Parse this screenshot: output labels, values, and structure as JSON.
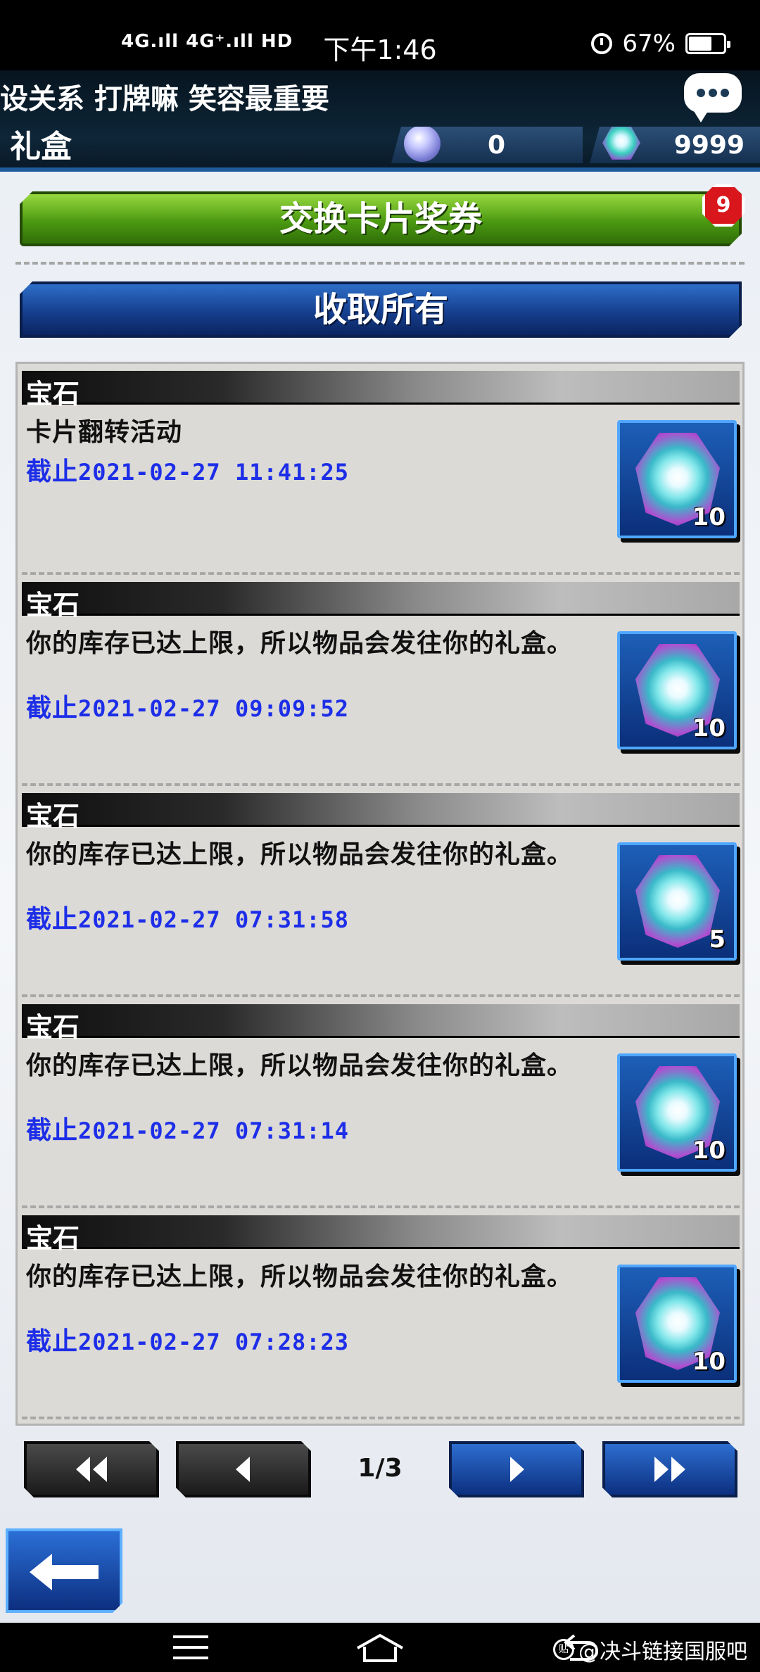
{
  "status_bar": {
    "signal": "4G.ıll 4G⁺.ıll HD",
    "time": "下午1:46",
    "battery": "67%"
  },
  "header": {
    "marquee": "设关系 打牌嘛 笑容最重要",
    "title": "礼盒",
    "currency_orb": "0",
    "currency_gem": "9999"
  },
  "buttons": {
    "exchange_label": "交换卡片奖券",
    "exchange_badge": "9",
    "collect_label": "收取所有"
  },
  "items": [
    {
      "category": "宝石",
      "message": "卡片翻转活动",
      "deadline_label": "截止",
      "deadline": "2021-02-27 11:41:25",
      "count": "10"
    },
    {
      "category": "宝石",
      "message": "你的库存已达上限，所以物品会发往你的礼盒。",
      "deadline_label": "截止",
      "deadline": "2021-02-27 09:09:52",
      "count": "10"
    },
    {
      "category": "宝石",
      "message": "你的库存已达上限，所以物品会发往你的礼盒。",
      "deadline_label": "截止",
      "deadline": "2021-02-27 07:31:58",
      "count": "5"
    },
    {
      "category": "宝石",
      "message": "你的库存已达上限，所以物品会发往你的礼盒。",
      "deadline_label": "截止",
      "deadline": "2021-02-27 07:31:14",
      "count": "10"
    },
    {
      "category": "宝石",
      "message": "你的库存已达上限，所以物品会发往你的礼盒。",
      "deadline_label": "截止",
      "deadline": "2021-02-27 07:28:23",
      "count": "10"
    }
  ],
  "pagination": {
    "indicator": "1/3"
  },
  "watermark": "@决斗链接国服吧"
}
